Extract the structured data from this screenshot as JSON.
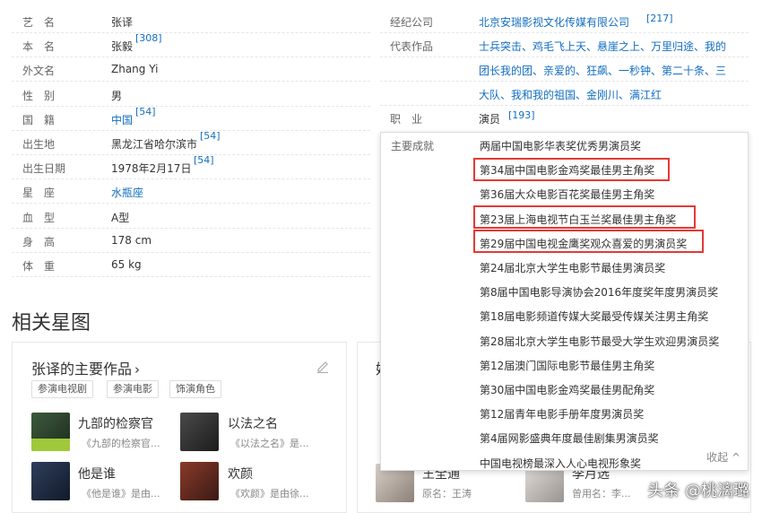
{
  "info_left": [
    {
      "label": "艺　名",
      "value": "张译"
    },
    {
      "label": "本　名",
      "value": "张毅",
      "ref": "[308]"
    },
    {
      "label": "外文名",
      "value": "Zhang Yi"
    },
    {
      "label": "性　别",
      "value": "男"
    },
    {
      "label": "国　籍",
      "value": "中国",
      "ref": "[54]",
      "link": true
    },
    {
      "label": "出生地",
      "value": "黑龙江省哈尔滨市",
      "ref": "[54]"
    },
    {
      "label": "出生日期",
      "value": "1978年2月17日",
      "ref": "[54]"
    },
    {
      "label": "星　座",
      "value": "水瓶座",
      "link": true
    },
    {
      "label": "血　型",
      "value": "A型"
    },
    {
      "label": "身　高",
      "value": "178 cm"
    },
    {
      "label": "体　重",
      "value": "65 kg"
    }
  ],
  "info_right": {
    "agency_label": "经纪公司",
    "agency_value": "北京安瑞影视文化传媒有限公司",
    "agency_ref": "[217]",
    "works_label": "代表作品",
    "works_lines": [
      "士兵突击、鸡毛飞上天、悬崖之上、万里归途、我的",
      "团长我的团、亲爱的、狂飙、一秒钟、第二十条、三",
      "大队、我和我的祖国、金刚川、满江红"
    ],
    "job_label": "职　业",
    "job_value": "演员",
    "job_ref": "[193]"
  },
  "achievements": {
    "label": "主要成就",
    "items": [
      "两届中国电影华表奖优秀男演员奖",
      "第34届中国电影金鸡奖最佳男主角奖",
      "第36届大众电影百花奖最佳男主角奖",
      "第23届上海电视节白玉兰奖最佳男主角奖",
      "第29届中国电视金鹰奖观众喜爱的男演员奖",
      "第24届北京大学生电影节最佳男演员奖",
      "第8届中国电影导演协会2016年度奖年度男演员奖",
      "第18届电影频道传媒大奖最受传媒关注男主角奖",
      "第28届北京大学生电影节最受大学生欢迎男演员奖",
      "第12届澳门国际电影节最佳男主角奖",
      "第30届中国电影金鸡奖最佳男配角奖",
      "第12届青年电影手册年度男演员奖",
      "第4届网影盛典年度最佳剧集男演员奖",
      "中国电视榜最深入人心电视形象奖"
    ],
    "collapse_label": "收起 ^"
  },
  "related": {
    "section_title": "相关星图",
    "card_title": "张译的主要作品",
    "card_chevron": "›",
    "tags": [
      "参演电视剧",
      "参演电影",
      "饰演角色"
    ],
    "works": [
      {
        "title": "九部的检察官",
        "desc": "《九部的检察官..."
      },
      {
        "title": "以法之名",
        "desc": "《以法之名》是..."
      },
      {
        "title": "他是谁",
        "desc": "《他是谁》是由..."
      },
      {
        "title": "欢颜",
        "desc": "《欢颜》是由徐..."
      }
    ],
    "second_card_partial": "娱",
    "people": [
      {
        "name": "王全通",
        "sub": "原名：王涛"
      },
      {
        "name": "李月选",
        "sub": "曾用名：李..."
      }
    ]
  },
  "watermark": "头条 @桃漓璐",
  "colors": {
    "link": "#136ec2",
    "highlight": "#e53935"
  }
}
